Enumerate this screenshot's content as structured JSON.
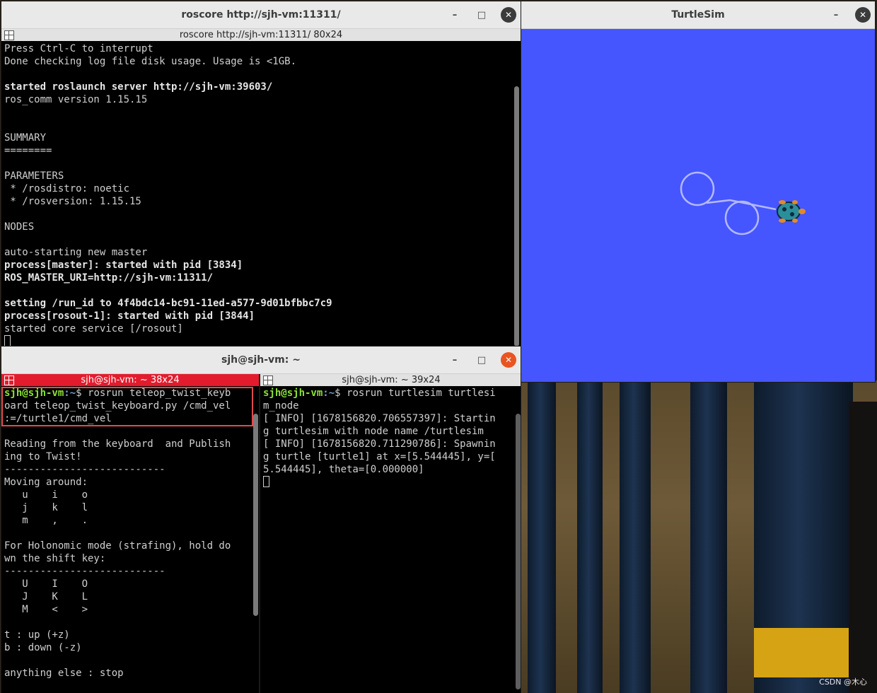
{
  "roscore_window": {
    "title": "roscore http://sjh-vm:11311/",
    "tab_label": "roscore http://sjh-vm:11311/ 80x24",
    "lines": [
      {
        "t": "Press Ctrl-C to interrupt",
        "s": ""
      },
      {
        "t": "Done checking log file disk usage. Usage is <1GB.",
        "s": ""
      },
      {
        "t": "",
        "s": ""
      },
      {
        "t": "started roslaunch server http://sjh-vm:39603/",
        "s": "b"
      },
      {
        "t": "ros_comm version 1.15.15",
        "s": ""
      },
      {
        "t": "",
        "s": ""
      },
      {
        "t": "",
        "s": ""
      },
      {
        "t": "SUMMARY",
        "s": ""
      },
      {
        "t": "========",
        "s": ""
      },
      {
        "t": "",
        "s": ""
      },
      {
        "t": "PARAMETERS",
        "s": ""
      },
      {
        "t": " * /rosdistro: noetic",
        "s": ""
      },
      {
        "t": " * /rosversion: 1.15.15",
        "s": ""
      },
      {
        "t": "",
        "s": ""
      },
      {
        "t": "NODES",
        "s": ""
      },
      {
        "t": "",
        "s": ""
      },
      {
        "t": "auto-starting new master",
        "s": ""
      },
      {
        "t": "process[master]: started with pid [3834]",
        "s": "b"
      },
      {
        "t": "ROS_MASTER_URI=http://sjh-vm:11311/",
        "s": "b"
      },
      {
        "t": "",
        "s": ""
      },
      {
        "t": "setting /run_id to 4f4bdc14-bc91-11ed-a577-9d01bfbbc7c9",
        "s": "b"
      },
      {
        "t": "process[rosout-1]: started with pid [3844]",
        "s": "b"
      },
      {
        "t": "started core service [/rosout]",
        "s": ""
      }
    ]
  },
  "turtlesim_window": {
    "title": "TurtleSim",
    "background_color": "#4556ff",
    "path_color": "#b3b8ff"
  },
  "split_window": {
    "title": "sjh@sjh-vm: ~",
    "left_tab_label": "sjh@sjh-vm: ~ 38x24",
    "right_tab_label": "sjh@sjh-vm: ~ 39x24",
    "prompt_user": "sjh@sjh-vm",
    "prompt_path": ":~",
    "prompt_symbol": "$ ",
    "left_command_lines": [
      "rosrun teleop_twist_keyb",
      "oard teleop_twist_keyboard.py /cmd_vel",
      ":=/turtle1/cmd_vel"
    ],
    "left_lines": [
      "",
      "Reading from the keyboard  and Publish",
      "ing to Twist!",
      "---------------------------",
      "Moving around:",
      "   u    i    o",
      "   j    k    l",
      "   m    ,    .",
      "",
      "For Holonomic mode (strafing), hold do",
      "wn the shift key:",
      "---------------------------",
      "   U    I    O",
      "   J    K    L",
      "   M    <    >",
      "",
      "t : up (+z)",
      "b : down (-z)",
      "",
      "anything else : stop"
    ],
    "right_command_lines": [
      "rosrun turtlesim turtlesi",
      "m_node"
    ],
    "right_lines": [
      "[ INFO] [1678156820.706557397]: Startin",
      "g turtlesim with node name /turtlesim",
      "[ INFO] [1678156820.711290786]: Spawnin",
      "g turtle [turtle1] at x=[5.544445], y=[",
      "5.544445], theta=[0.000000]"
    ]
  },
  "window_controls": {
    "minimize": "–",
    "maximize": "□",
    "close": "✕"
  },
  "watermark": "CSDN @木心"
}
